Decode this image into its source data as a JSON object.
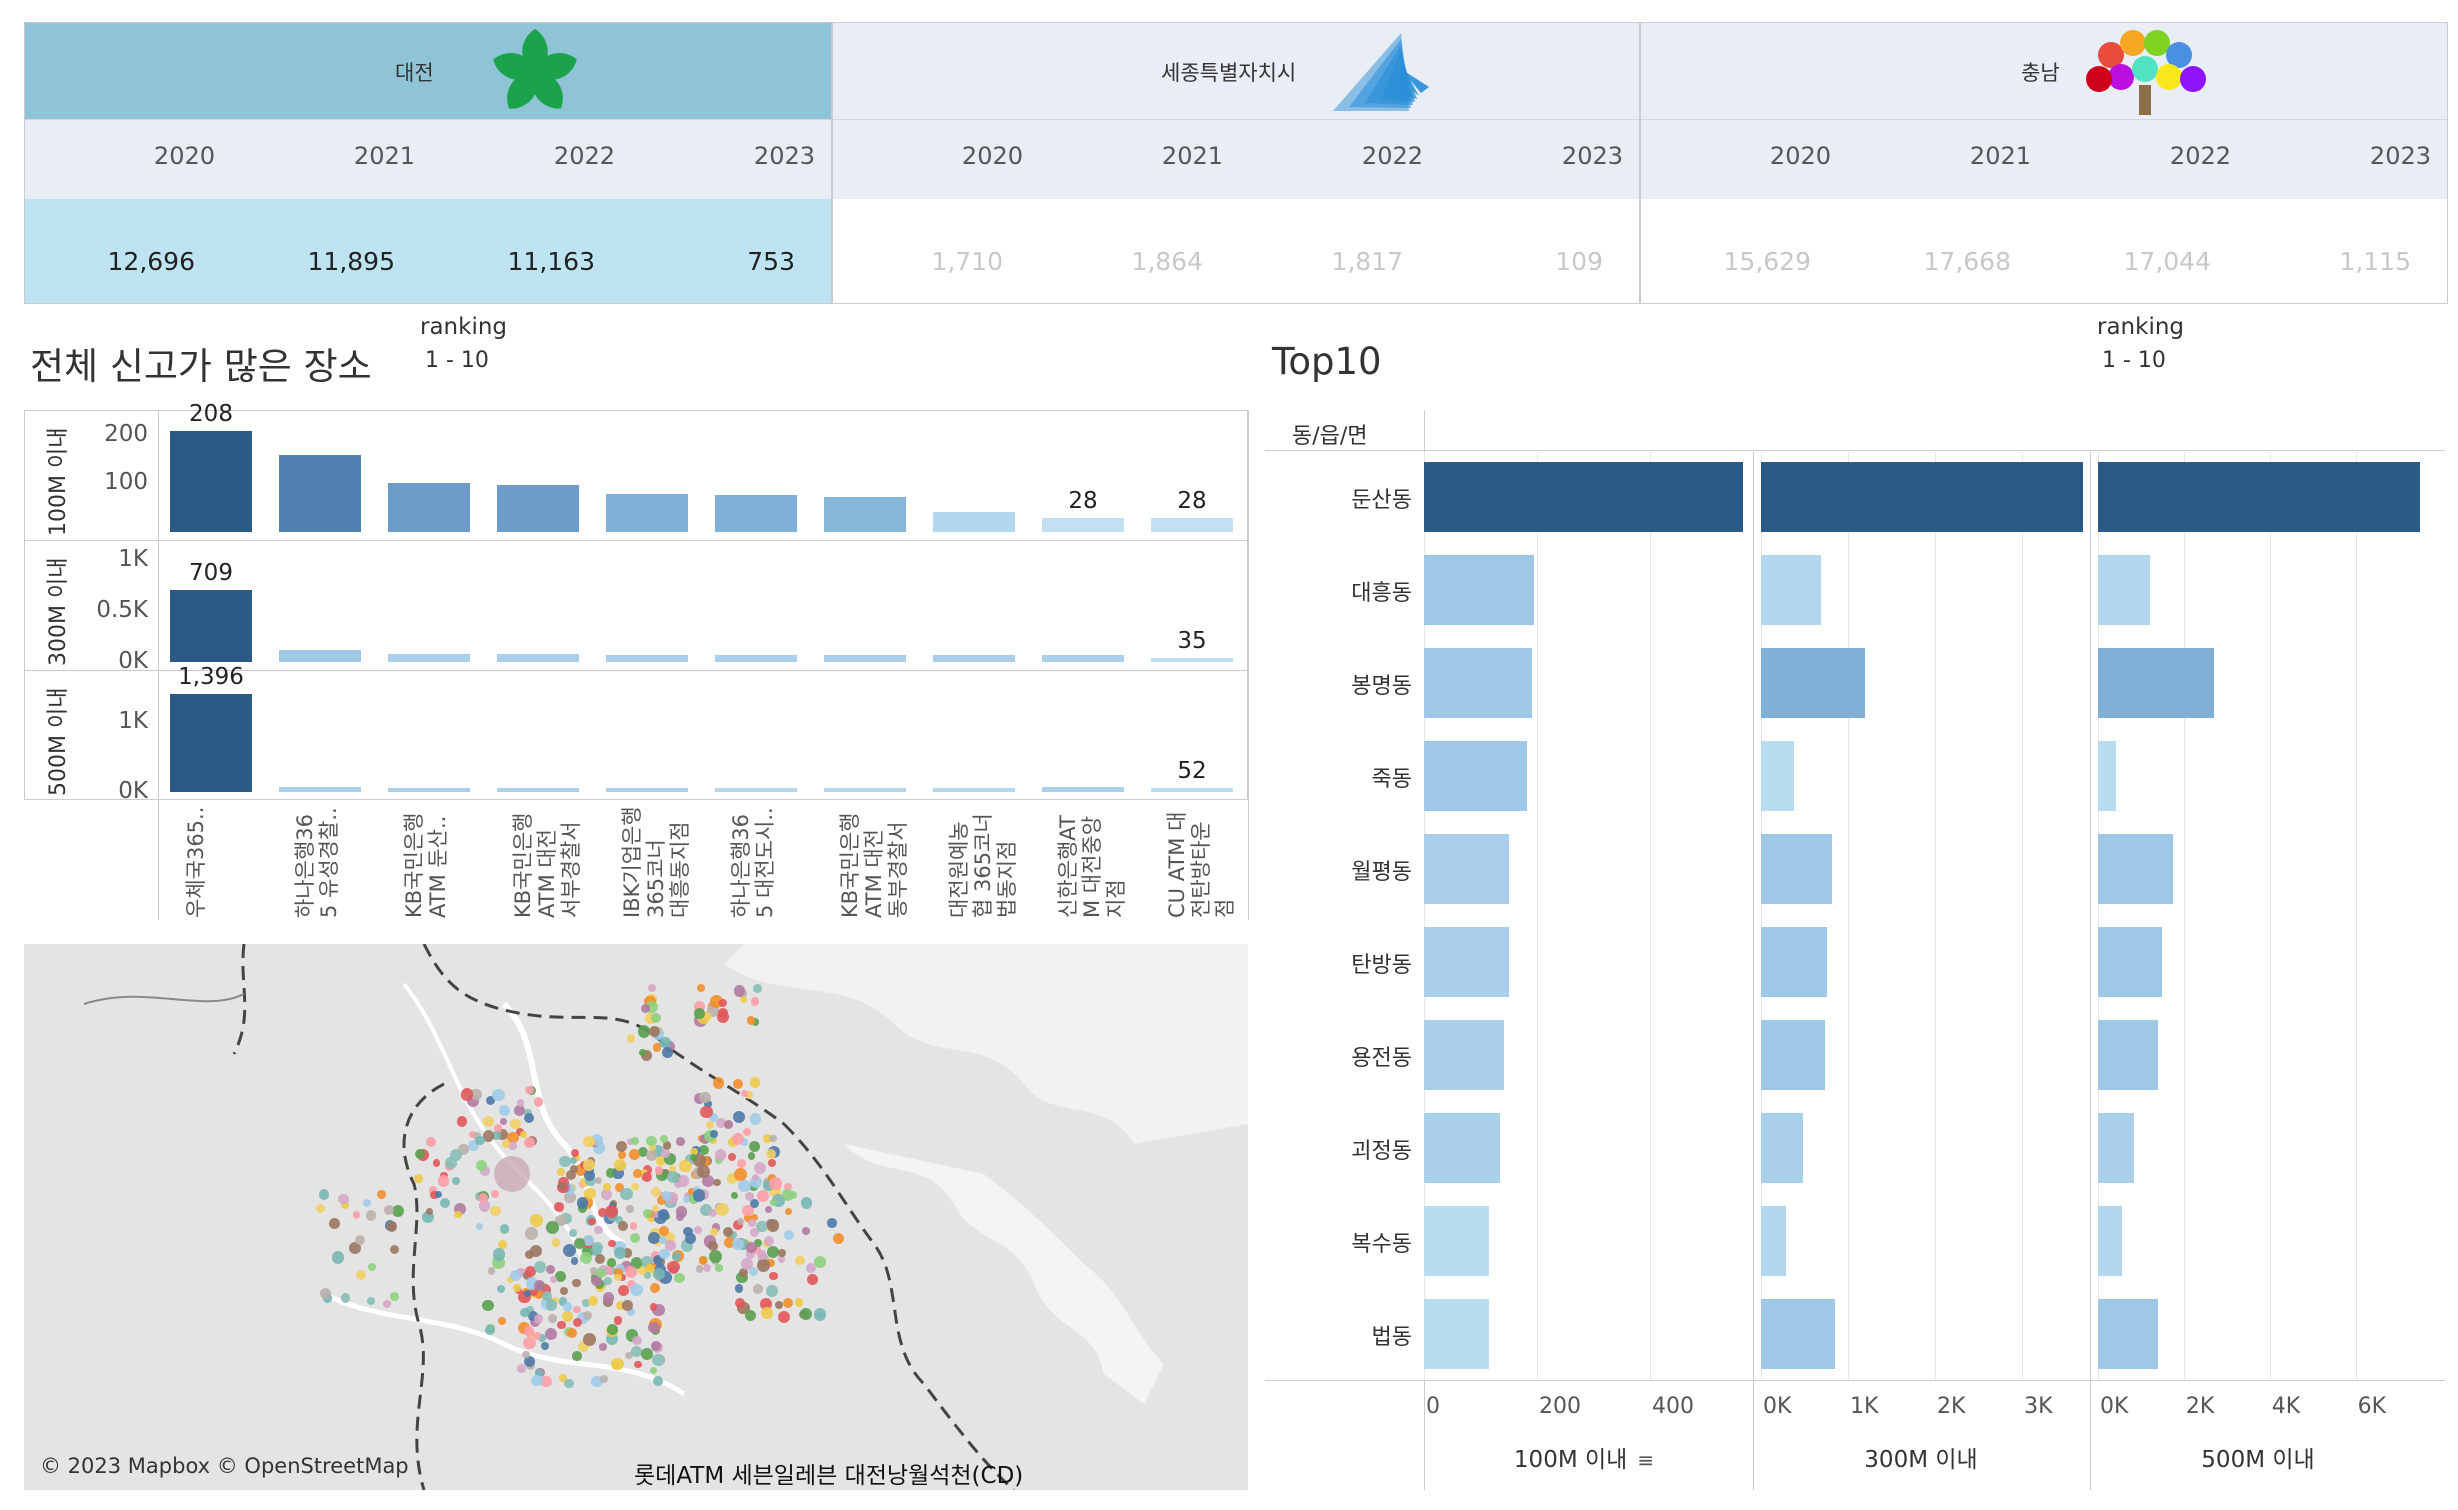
{
  "regions": [
    {
      "name": "대전",
      "years": [
        "2020",
        "2021",
        "2022",
        "2023"
      ],
      "values": [
        "12,696",
        "11,895",
        "11,163",
        "753"
      ],
      "selected": true
    },
    {
      "name": "세종특별자치시",
      "years": [
        "2020",
        "2021",
        "2022",
        "2023"
      ],
      "values": [
        "1,710",
        "1,864",
        "1,817",
        "109"
      ],
      "selected": false
    },
    {
      "name": "충남",
      "years": [
        "2020",
        "2021",
        "2022",
        "2023"
      ],
      "values": [
        "15,629",
        "17,668",
        "17,044",
        "1,115"
      ],
      "selected": false
    }
  ],
  "left_section": {
    "title": "전체 신고가 많은 장소",
    "ranking_label": "ranking",
    "ranking_value": "1 - 10"
  },
  "right_section": {
    "title": "Top10",
    "ranking_label": "ranking",
    "ranking_value": "1 - 10",
    "row_header": "동/읍/면"
  },
  "map": {
    "credit": "© 2023 Mapbox © OpenStreetMap",
    "hover_label": "롯데ATM 세븐일레븐 대전낭월석천(CD)"
  },
  "colors": {
    "dark": "#2c5a86",
    "mid": "#4f80b0",
    "mid2": "#7fb0d6",
    "light": "#9fc7e6",
    "lighter": "#b9dcf0",
    "selected_bg": "#bde4f0",
    "region_header": "#8ec4d6"
  },
  "chart_data": [
    {
      "type": "bar",
      "title": "전체 신고가 많은 장소",
      "categories": [
        "우체국365..",
        "하나은행36\n5 유성경찰..",
        "KB국민은행\nATM 둔산..",
        "KB국민은행\nATM 대전\n서부경찰서",
        "IBK기업은행\n365코너\n대흥동지점",
        "하나은행36\n5 대전도시..",
        "KB국민은행\nATM 대전\n동부경찰서",
        "대전원예농\n협 365코너\n법동지점",
        "신한은행AT\nM 대전중앙\n지점",
        "CU ATM 대\n전탄방타운\n점"
      ],
      "panels": [
        {
          "name": "100M 이내",
          "ticks": [
            "200",
            "100"
          ],
          "ylim": [
            0,
            230
          ],
          "values": [
            208,
            158,
            100,
            96,
            78,
            76,
            72,
            42,
            28,
            28
          ],
          "labels": {
            "0": "208",
            "8": "28",
            "9": "28"
          }
        },
        {
          "name": "300M 이내",
          "ticks": [
            "1K",
            "0.5K",
            "0K"
          ],
          "ylim": [
            0,
            1100
          ],
          "values": [
            709,
            115,
            80,
            75,
            68,
            68,
            65,
            65,
            65,
            35
          ],
          "labels": {
            "0": "709",
            "9": "35"
          }
        },
        {
          "name": "500M 이내",
          "ticks": [
            "1K",
            "0K"
          ],
          "ylim": [
            0,
            1600
          ],
          "values": [
            1396,
            70,
            60,
            60,
            60,
            55,
            55,
            52,
            70,
            52
          ],
          "labels": {
            "0": "1,396",
            "9": "52"
          }
        }
      ]
    },
    {
      "type": "bar",
      "title": "Top10",
      "categories": [
        "둔산동",
        "대흥동",
        "봉명동",
        "죽동",
        "월평동",
        "탄방동",
        "용전동",
        "괴정동",
        "복수동",
        "법동"
      ],
      "panels": [
        {
          "name": "100M 이내",
          "ticks": [
            "0",
            "200",
            "400"
          ],
          "xlim": [
            0,
            570
          ],
          "values": [
            565,
            195,
            192,
            182,
            150,
            150,
            142,
            135,
            115,
            115
          ]
        },
        {
          "name": "300M 이내",
          "ticks": [
            "0K",
            "1K",
            "2K",
            "3K"
          ],
          "xlim": [
            0,
            3700
          ],
          "values": [
            3700,
            690,
            1200,
            380,
            820,
            760,
            730,
            480,
            290,
            850
          ]
        },
        {
          "name": "500M 이내",
          "ticks": [
            "0K",
            "2K",
            "4K",
            "6K"
          ],
          "xlim": [
            0,
            7500
          ],
          "values": [
            7500,
            1200,
            2700,
            420,
            1750,
            1500,
            1400,
            850,
            550,
            1400
          ]
        }
      ]
    }
  ]
}
